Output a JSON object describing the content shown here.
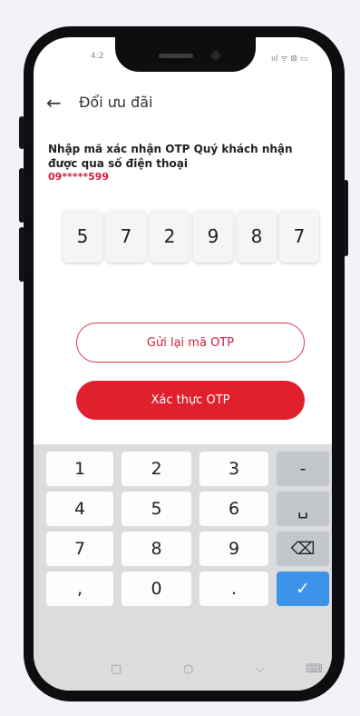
{
  "status": {
    "time": "4:2",
    "icons": "ııl ᯤ ⊠ ▭"
  },
  "header": {
    "title": "Đổi ưu đãi",
    "back_icon": "←"
  },
  "message": {
    "line": "Nhập mã xác nhận OTP Quý khách nhận được qua số điện thoại",
    "phone": "09*****599"
  },
  "otp": {
    "digits": [
      "5",
      "7",
      "2",
      "9",
      "8",
      "7"
    ]
  },
  "buttons": {
    "resend": "Gửi lại mã OTP",
    "verify": "Xác thực OTP"
  },
  "keyboard": {
    "rows": [
      [
        "1",
        "2",
        "3",
        "-"
      ],
      [
        "4",
        "5",
        "6",
        "␣"
      ],
      [
        "7",
        "8",
        "9",
        "⌫"
      ],
      [
        ",",
        "0",
        ".",
        "✓"
      ]
    ]
  },
  "navbar": {
    "recent": "▢",
    "home": "○",
    "back": "⌵",
    "keyboard": "⌨"
  },
  "colors": {
    "accent": "#e1202e",
    "done": "#3d93e8"
  }
}
